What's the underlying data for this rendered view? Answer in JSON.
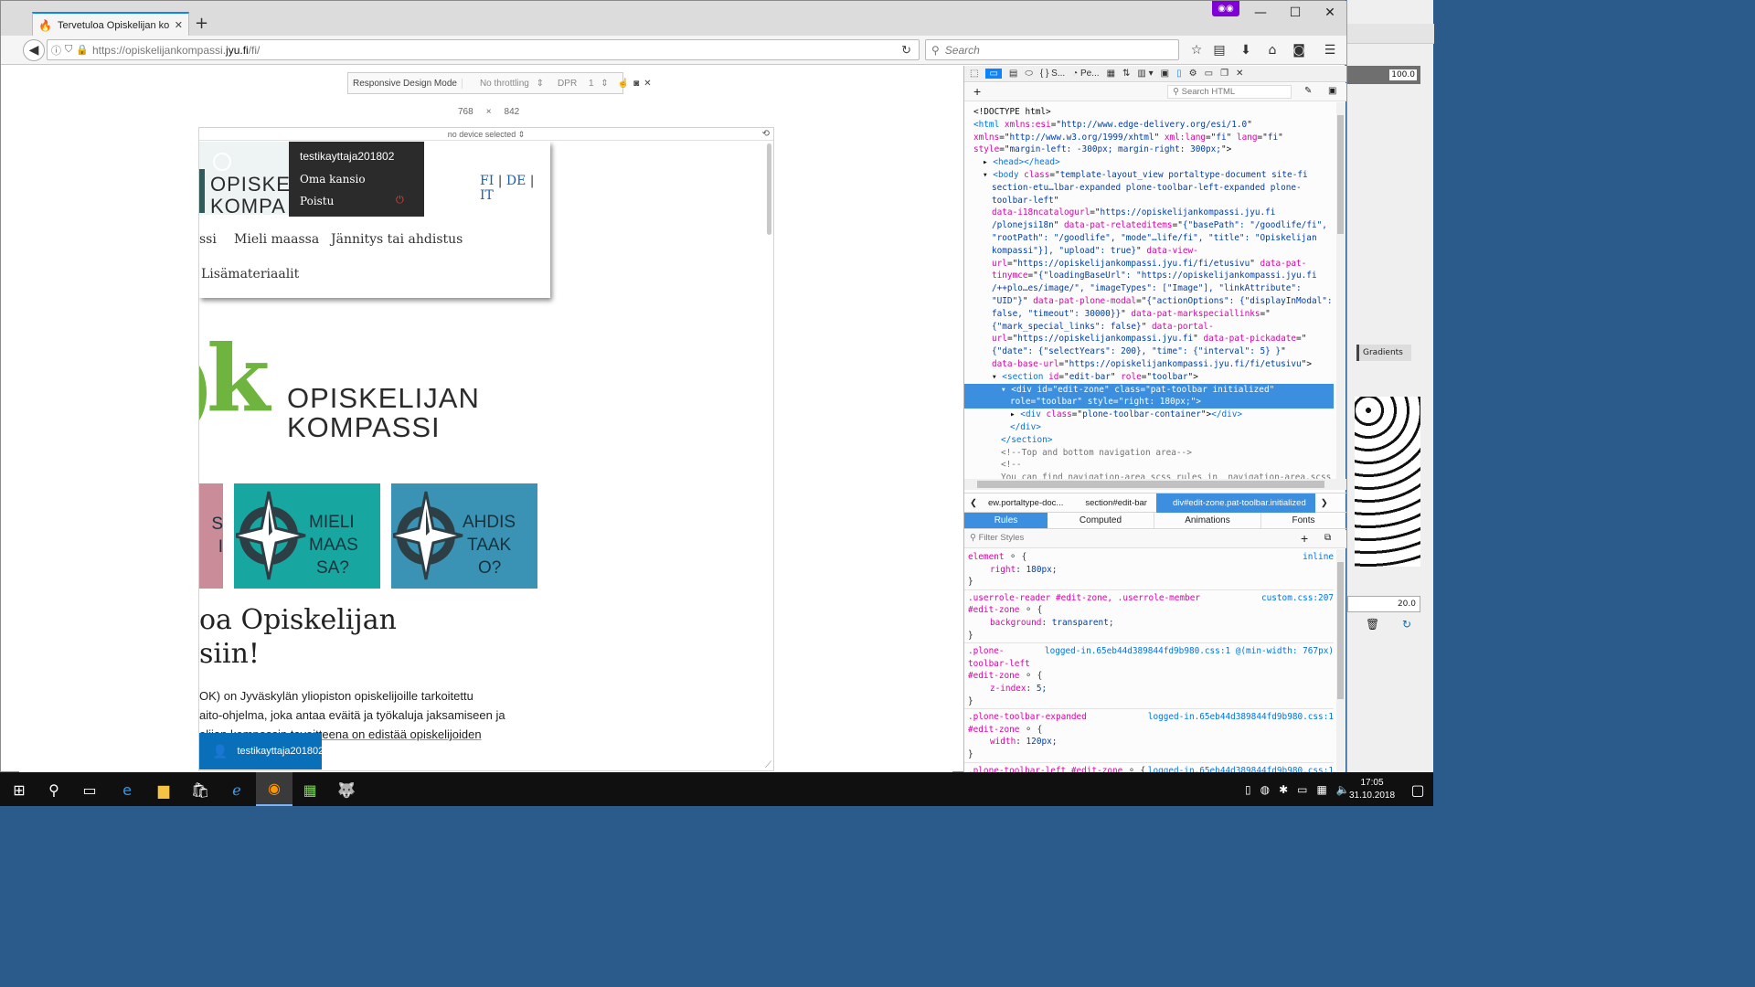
{
  "browser": {
    "tab_title": "Tervetuloa Opiskelijan ko...",
    "url_prefix": "https://opiskelijankompassi.",
    "url_domain": "jyu.fi",
    "url_suffix": "/fi/",
    "search_placeholder": "Search",
    "new_tab": "+",
    "tab_close": "✕"
  },
  "rdm": {
    "label": "Responsive Design Mode",
    "throttling": "No throttling",
    "dpr_label": "DPR",
    "dpr_value": "1",
    "width": "768",
    "times": "×",
    "height": "842",
    "device": "no device selected"
  },
  "site": {
    "user_menu": {
      "username": "testikayttaja201802",
      "items": [
        "Oma kansio",
        "Poistu"
      ]
    },
    "header_logo_line1": "OPISKEL",
    "header_logo_line2": "KOMPA",
    "lang": [
      "FI",
      "DE",
      "IT"
    ],
    "lang_sep": "|",
    "nav": [
      "ssi",
      "Mieli maassa",
      "Jännitys tai ahdistus",
      "Lisämateriaalit"
    ],
    "logo_letter": "k",
    "logo_line1": "OPISKELIJAN",
    "logo_line2": "KOMPASSI",
    "tiles": [
      {
        "line1": "S",
        "line2": "I",
        "line3": ""
      },
      {
        "line1": "MIELI",
        "line2": "MAAS",
        "line3": "SA?"
      },
      {
        "line1": "AHDIS",
        "line2": "TAAK",
        "line3": "O?"
      }
    ],
    "heading_line1": "oa Opiskelijan",
    "heading_line2": "siin!",
    "para": [
      "OK) on Jyväskylän yliopiston opiskelijoille tarkoitettu",
      "aito-ohjelma, joka antaa eväitä ja työkaluja jaksamiseen ja",
      "elijan kompassin tavoitteena on edistää opiskelijoiden"
    ],
    "toolbar_user": "testikayttaja201802"
  },
  "devtools": {
    "toolbar_tabs": [
      "S...",
      "Pe..."
    ],
    "search_html_placeholder": "Search HTML",
    "breadcrumbs": [
      "ew.portaltype-doc...",
      "section#edit-bar",
      "div#edit-zone.pat-toolbar.initialized"
    ],
    "side_tabs": [
      "Rules",
      "Computed",
      "Animations",
      "Fonts"
    ],
    "filter_placeholder": "Filter Styles",
    "html_lines": [
      {
        "indent": 0,
        "parts": [
          [
            "tx",
            "<!DOCTYPE html>"
          ]
        ]
      },
      {
        "indent": 0,
        "parts": [
          [
            "tg",
            "<html "
          ],
          [
            "at",
            "xmlns:esi"
          ],
          [
            "tx",
            "=\""
          ],
          [
            "vl",
            "http://www.edge-delivery.org/esi/1.0"
          ],
          [
            "tx",
            "\""
          ]
        ]
      },
      {
        "indent": 0,
        "parts": [
          [
            "at",
            "xmlns"
          ],
          [
            "tx",
            "=\""
          ],
          [
            "vl",
            "http://www.w3.org/1999/xhtml"
          ],
          [
            "tx",
            "\" "
          ],
          [
            "at",
            "xml:lang"
          ],
          [
            "tx",
            "=\""
          ],
          [
            "vl",
            "fi"
          ],
          [
            "tx",
            "\" "
          ],
          [
            "at",
            "lang"
          ],
          [
            "tx",
            "=\""
          ],
          [
            "vl",
            "fi"
          ],
          [
            "tx",
            "\""
          ]
        ]
      },
      {
        "indent": 0,
        "parts": [
          [
            "at",
            "style"
          ],
          [
            "tx",
            "=\""
          ],
          [
            "vl",
            "margin-left: -300px; margin-right: 300px;"
          ],
          [
            "tx",
            "\">"
          ]
        ]
      },
      {
        "indent": 1,
        "parts": [
          [
            "tx",
            "▸ "
          ],
          [
            "tg",
            "<head></head>"
          ]
        ]
      },
      {
        "indent": 1,
        "parts": [
          [
            "tx",
            "▾ "
          ],
          [
            "tg",
            "<body "
          ],
          [
            "at",
            "class"
          ],
          [
            "tx",
            "=\""
          ],
          [
            "vl",
            "template-layout_view portaltype-document site-fi"
          ]
        ]
      },
      {
        "indent": 2,
        "parts": [
          [
            "vl",
            "section-etu…lbar-expanded plone-toolbar-left-expanded plone-"
          ]
        ]
      },
      {
        "indent": 2,
        "parts": [
          [
            "vl",
            "toolbar-left"
          ],
          [
            "tx",
            "\""
          ]
        ]
      },
      {
        "indent": 2,
        "parts": [
          [
            "at",
            "data-i18ncatalogurl"
          ],
          [
            "tx",
            "=\""
          ],
          [
            "vl",
            "https://opiskelijankompassi.jyu.fi"
          ]
        ]
      },
      {
        "indent": 2,
        "parts": [
          [
            "vl",
            "/plonejsi18n"
          ],
          [
            "tx",
            "\" "
          ],
          [
            "at",
            "data-pat-relateditems"
          ],
          [
            "tx",
            "=\""
          ],
          [
            "vl",
            "{\"basePath\": \"/goodlife/fi\","
          ]
        ]
      },
      {
        "indent": 2,
        "parts": [
          [
            "vl",
            "\"rootPath\": \"/goodlife\", \"mode\"…life/fi\", \"title\": \"Opiskelijan"
          ]
        ]
      },
      {
        "indent": 2,
        "parts": [
          [
            "vl",
            "kompassi\"}], \"upload\": true}"
          ],
          [
            "tx",
            "\" "
          ],
          [
            "at",
            "data-view-"
          ]
        ]
      },
      {
        "indent": 2,
        "parts": [
          [
            "at",
            "url"
          ],
          [
            "tx",
            "=\""
          ],
          [
            "vl",
            "https://opiskelijankompassi.jyu.fi/fi/etusivu"
          ],
          [
            "tx",
            "\" "
          ],
          [
            "at",
            "data-pat-"
          ]
        ]
      },
      {
        "indent": 2,
        "parts": [
          [
            "at",
            "tinymce"
          ],
          [
            "tx",
            "=\""
          ],
          [
            "vl",
            "{\"loadingBaseUrl\": \"https://opiskelijankompassi.jyu.fi"
          ]
        ]
      },
      {
        "indent": 2,
        "parts": [
          [
            "vl",
            "/++plo…es/image/\", \"imageTypes\": [\"Image\"], \"linkAttribute\":"
          ]
        ]
      },
      {
        "indent": 2,
        "parts": [
          [
            "vl",
            "\"UID\"}"
          ],
          [
            "tx",
            "\" "
          ],
          [
            "at",
            "data-pat-plone-modal"
          ],
          [
            "tx",
            "=\""
          ],
          [
            "vl",
            "{\"actionOptions\": {\"displayInModal\":"
          ]
        ]
      },
      {
        "indent": 2,
        "parts": [
          [
            "vl",
            "false, \"timeout\": 30000}}"
          ],
          [
            "tx",
            "\" "
          ],
          [
            "at",
            "data-pat-markspeciallinks"
          ],
          [
            "tx",
            "=\""
          ]
        ]
      },
      {
        "indent": 2,
        "parts": [
          [
            "vl",
            "{\"mark_special_links\": false}"
          ],
          [
            "tx",
            "\" "
          ],
          [
            "at",
            "data-portal-"
          ]
        ]
      },
      {
        "indent": 2,
        "parts": [
          [
            "at",
            "url"
          ],
          [
            "tx",
            "=\""
          ],
          [
            "vl",
            "https://opiskelijankompassi.jyu.fi"
          ],
          [
            "tx",
            "\" "
          ],
          [
            "at",
            "data-pat-pickadate"
          ],
          [
            "tx",
            "=\""
          ]
        ]
      },
      {
        "indent": 2,
        "parts": [
          [
            "vl",
            "{\"date\": {\"selectYears\": 200}, \"time\": {\"interval\": 5} }"
          ],
          [
            "tx",
            "\""
          ]
        ]
      },
      {
        "indent": 2,
        "parts": [
          [
            "at",
            "data-base-url"
          ],
          [
            "tx",
            "=\""
          ],
          [
            "vl",
            "https://opiskelijankompassi.jyu.fi/fi/etusivu"
          ],
          [
            "tx",
            "\">"
          ]
        ]
      },
      {
        "indent": 2,
        "parts": [
          [
            "tx",
            "▾ "
          ],
          [
            "tg",
            "<section "
          ],
          [
            "at",
            "id"
          ],
          [
            "tx",
            "=\""
          ],
          [
            "vl",
            "edit-bar"
          ],
          [
            "tx",
            "\" "
          ],
          [
            "at",
            "role"
          ],
          [
            "tx",
            "=\""
          ],
          [
            "vl",
            "toolbar"
          ],
          [
            "tx",
            "\">"
          ]
        ]
      },
      {
        "indent": 3,
        "selected": true,
        "parts": [
          [
            "tx",
            "▾ "
          ],
          [
            "tg",
            "<div "
          ],
          [
            "at",
            "id"
          ],
          [
            "tx",
            "=\""
          ],
          [
            "vl",
            "edit-zone"
          ],
          [
            "tx",
            "\" "
          ],
          [
            "at",
            "class"
          ],
          [
            "tx",
            "=\""
          ],
          [
            "vl",
            "pat-toolbar initialized"
          ],
          [
            "tx",
            "\""
          ]
        ]
      },
      {
        "indent": 4,
        "selected": true,
        "parts": [
          [
            "at",
            "role"
          ],
          [
            "tx",
            "=\""
          ],
          [
            "vl",
            "toolbar"
          ],
          [
            "tx",
            "\" "
          ],
          [
            "at",
            "style"
          ],
          [
            "tx",
            "=\""
          ],
          [
            "vl",
            "right: 180px;"
          ],
          [
            "tx",
            "\">"
          ]
        ]
      },
      {
        "indent": 4,
        "parts": [
          [
            "tx",
            "▸ "
          ],
          [
            "tg",
            "<div "
          ],
          [
            "at",
            "class"
          ],
          [
            "tx",
            "=\""
          ],
          [
            "vl",
            "plone-toolbar-container"
          ],
          [
            "tx",
            "\">"
          ],
          [
            "tg",
            "</div>"
          ]
        ]
      },
      {
        "indent": 4,
        "parts": [
          [
            "tg",
            "</div>"
          ]
        ]
      },
      {
        "indent": 3,
        "parts": [
          [
            "tg",
            "</section>"
          ]
        ]
      },
      {
        "indent": 3,
        "parts": [
          [
            "cm",
            "<!--Top and bottom navigation area-->"
          ]
        ]
      },
      {
        "indent": 3,
        "parts": [
          [
            "cm",
            "<!--"
          ]
        ]
      },
      {
        "indent": 3,
        "parts": [
          [
            "cm",
            "You can find navigation-area scss rules in _navigation-area.scss"
          ]
        ]
      }
    ],
    "rules": [
      {
        "selector": "element",
        "source": "inline",
        "decls": [
          [
            "right",
            "180px;"
          ]
        ]
      },
      {
        "selector": ".userrole-reader #edit-zone, .userrole-member",
        "selector2": "#edit-zone",
        "source": "custom.css:207",
        "decls": [
          [
            "background",
            "transparent;"
          ]
        ]
      },
      {
        "selector": ".plone-",
        "selector_b": "toolbar-left",
        "selector2": "#edit-zone",
        "source": "logged-in.65eb44d389844fd9b980.css:1 @(min-width: 767px)",
        "decls": [
          [
            "z-index",
            "5;"
          ]
        ]
      },
      {
        "selector": ".plone-toolbar-expanded",
        "selector2": "#edit-zone",
        "source": "logged-in.65eb44d389844fd9b980.css:1",
        "decls": [
          [
            "width",
            "120px;"
          ]
        ]
      },
      {
        "selector": ".plone-toolbar-left #edit-zone",
        "source": "logged-in.65eb44d389844fd9b980.css:1",
        "decls": []
      }
    ]
  },
  "gimp": {
    "value1": "100.0",
    "tab": "Gradients",
    "value2": "20.0"
  },
  "taskbar": {
    "time": "17:05",
    "date": "31.10.2018"
  },
  "colors": {
    "accent": "#0a84ff",
    "selection": "#3b8fde",
    "teal_tile": "#17a6a0",
    "blue_tile": "#3a93b4",
    "pink_tile": "#cb8c9a",
    "logo_green": "#6fb43f",
    "menu_dark": "#2b2b2b"
  }
}
